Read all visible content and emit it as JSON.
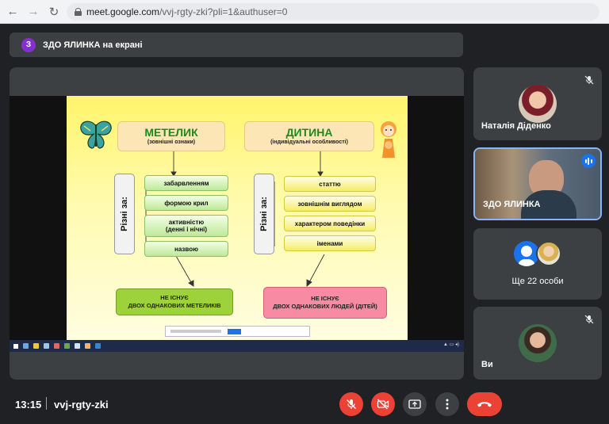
{
  "browser": {
    "url_host": "meet.google.com",
    "url_path": "/vvj-rgty-zki?pli=1&authuser=0"
  },
  "presentation": {
    "badge": "З",
    "title": "ЗДО ЯЛИНКА на екрані"
  },
  "slide": {
    "left_title": "МЕТЕЛИК",
    "left_sub": "(зовнішні ознаки)",
    "right_title": "ДИТИНА",
    "right_sub": "(індивідуальні особливості)",
    "left_vertical": "Різні за:",
    "right_vertical": "Різні за:",
    "left_items": [
      "забарвленням",
      "формою крил",
      "активністю",
      "(денні і нічні)",
      "назвою"
    ],
    "right_items": [
      "статтю",
      "зовнішнім виглядом",
      "характером поведінки",
      "іменами"
    ],
    "left_bottom_line1": "НЕ ІСНУЄ",
    "left_bottom_line2": "ДВОХ ОДНАКОВИХ МЕТЕЛИКІВ",
    "right_bottom_line1": "НЕ ІСНУЄ",
    "right_bottom_line2": "ДВОХ ОДНАКОВИХ ЛЮДЕЙ (ДІТЕЙ)"
  },
  "participants": [
    {
      "name": "Наталія Діденко"
    },
    {
      "name": "ЗДО ЯЛИНКА"
    },
    {
      "name": "Ще 22 особи"
    },
    {
      "name": "Ви"
    }
  ],
  "meeting": {
    "time": "13:15",
    "code": "vvj-rgty-zki"
  },
  "colors": {
    "mic_off_button": "#ea4335",
    "end_call_button": "#ea4335",
    "present_badge": "#8430ce",
    "active_speaker_border": "#8ab4f8"
  }
}
